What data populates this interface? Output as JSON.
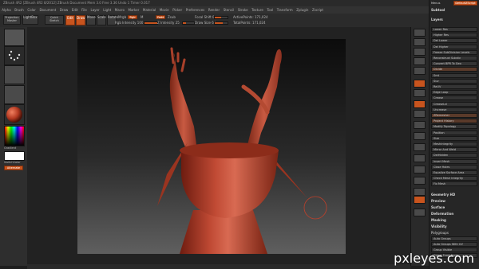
{
  "title_bar": {
    "text": "ZBrush 4R2  [ZBrush 4R2 8/2012]  ZBrush Document  Mem 3.0 Free 3.36 Undo 1 Timer 0.017"
  },
  "menu": {
    "items": [
      "Alpha",
      "Brush",
      "Color",
      "Document",
      "Draw",
      "Edit",
      "File",
      "Layer",
      "Light",
      "Macro",
      "Marker",
      "Material",
      "Movie",
      "Picker",
      "Preferences",
      "Render",
      "Stencil",
      "Stroke",
      "Texture",
      "Tool",
      "Transform",
      "Zplugin",
      "Zscript"
    ]
  },
  "top_shelf": {
    "projection_label": "Projection Master",
    "lightbox_label": "LightBox",
    "quick_sketch_label": "Quick Sketch",
    "edit_label": "Edit",
    "draw_label": "Draw",
    "move_label": "Move",
    "scale_label": "Scale",
    "rotate_label": "Rotate",
    "mrgb_label": "Mrgb",
    "rgb_label": "Rgb",
    "m_label": "M",
    "zadd_label": "Zadd",
    "zsub_label": "Zsub",
    "zcut_label": "Zcut",
    "rgb_intensity_label": "Rgb Intensity 100",
    "z_intensity_label": "Z Intensity 25",
    "focal_shift_label": "Focal Shift 0",
    "draw_size_label": "Draw Size 64",
    "active_points_label": "ActivePoints: 171,024",
    "total_points_label": "TotalPoints: 171,024"
  },
  "left_shelf": {
    "gradient_label": "Gradient",
    "switch_color_label": "SwitchColor",
    "alternate_label": "Alternate"
  },
  "palette": {
    "menus_label": "Menus",
    "default_zscript_label": "DefaultZScript",
    "subtool_label": "Subtool",
    "layers_label": "Layers",
    "geometry_hd_label": "Geometry HD",
    "preview_label": "Preview",
    "surface_label": "Surface",
    "deformation_label": "Deformation",
    "masking_label": "Masking",
    "visibility_label": "Visibility",
    "polygroups_label": "Polygroups",
    "auto_groups_label": "Auto Groups",
    "auto_groups_uv_label": "Auto Groups With UV",
    "group_visible_label": "Group Visible",
    "group_frontfaces_label": "Group Front Faces",
    "rows": [
      "Lower Res",
      "Higher Res",
      "Del Lower",
      "Del Higher",
      "Freeze SubDivision Levels",
      "Reconstruct Subdiv",
      "Convert BPR To Geo",
      "Divide",
      "Smt",
      "Suv",
      "ReUV",
      "Edge Loop",
      "Crease",
      "CreaseLvl",
      "Uncrease",
      "ZRemesher",
      "Project History",
      "Modify Topology",
      "Position",
      "Size",
      "MeshIntegrity",
      "Mirror And Weld",
      "DelHidden",
      "Insert Mesh",
      "Close Holes",
      "Equalize Surface Area",
      "Check Mesh Integrity",
      "Fix Mesh"
    ]
  },
  "watermark": "pxleyes.com",
  "colors": {
    "accent": "#c8541e",
    "model": "#b8402c",
    "background": "#1e1e1e"
  }
}
